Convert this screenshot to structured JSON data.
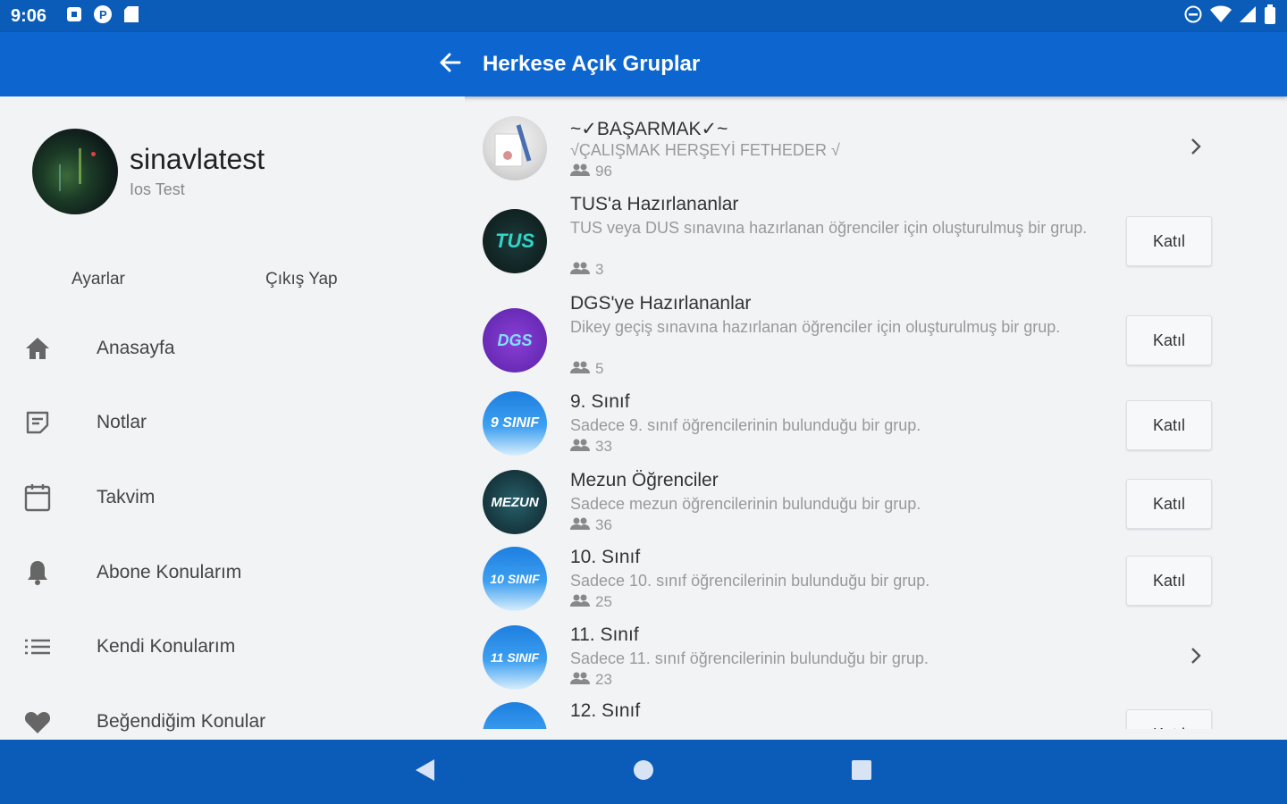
{
  "status_bar": {
    "time": "9:06"
  },
  "app_bar": {
    "title": "Herkese Açık Gruplar"
  },
  "drawer": {
    "user_name": "sinavlatest",
    "user_sub": "Ios Test",
    "settings_label": "Ayarlar",
    "logout_label": "Çıkış Yap",
    "items": [
      {
        "label": "Anasayfa",
        "icon": "home-icon"
      },
      {
        "label": "Notlar",
        "icon": "note-icon"
      },
      {
        "label": "Takvim",
        "icon": "calendar-icon"
      },
      {
        "label": "Abone Konularım",
        "icon": "bell-icon"
      },
      {
        "label": "Kendi Konularım",
        "icon": "list-icon"
      },
      {
        "label": "Beğendiğim Konular",
        "icon": "heart-icon"
      }
    ]
  },
  "groups": [
    {
      "name": "~✓BAŞARMAK✓~",
      "desc": "√ÇALIŞMAK HERŞEYİ FETHEDER √",
      "members": "96",
      "action": "chevron"
    },
    {
      "name": "TUS'a Hazırlananlar",
      "desc": "TUS veya DUS sınavına hazırlanan öğrenciler için oluşturulmuş bir grup.",
      "members": "3",
      "action": "Katıl",
      "avatar_text": "TUS"
    },
    {
      "name": "DGS'ye Hazırlananlar",
      "desc": "Dikey geçiş sınavına hazırlanan öğrenciler için oluşturulmuş bir grup.",
      "members": "5",
      "action": "Katıl",
      "avatar_text": "DGS"
    },
    {
      "name": "9. Sınıf",
      "desc": "Sadece 9. sınıf öğrencilerinin bulunduğu bir grup.",
      "members": "33",
      "action": "Katıl",
      "avatar_text": "9 SINIF"
    },
    {
      "name": "Mezun Öğrenciler",
      "desc": "Sadece mezun öğrencilerinin bulunduğu bir grup.",
      "members": "36",
      "action": "Katıl",
      "avatar_text": "MEZUN"
    },
    {
      "name": "10. Sınıf",
      "desc": "Sadece 10. sınıf öğrencilerinin bulunduğu bir grup.",
      "members": "25",
      "action": "Katıl",
      "avatar_text": "10 SINIF"
    },
    {
      "name": "11. Sınıf",
      "desc": "Sadece 11. sınıf öğrencilerinin bulunduğu bir grup.",
      "members": "23",
      "action": "chevron",
      "avatar_text": "11 SINIF"
    },
    {
      "name": "12. Sınıf",
      "action": "Katıl"
    }
  ],
  "colors": {
    "primary": "#0d66cf",
    "status": "#0b5cb8",
    "background": "#f2f3f5"
  }
}
